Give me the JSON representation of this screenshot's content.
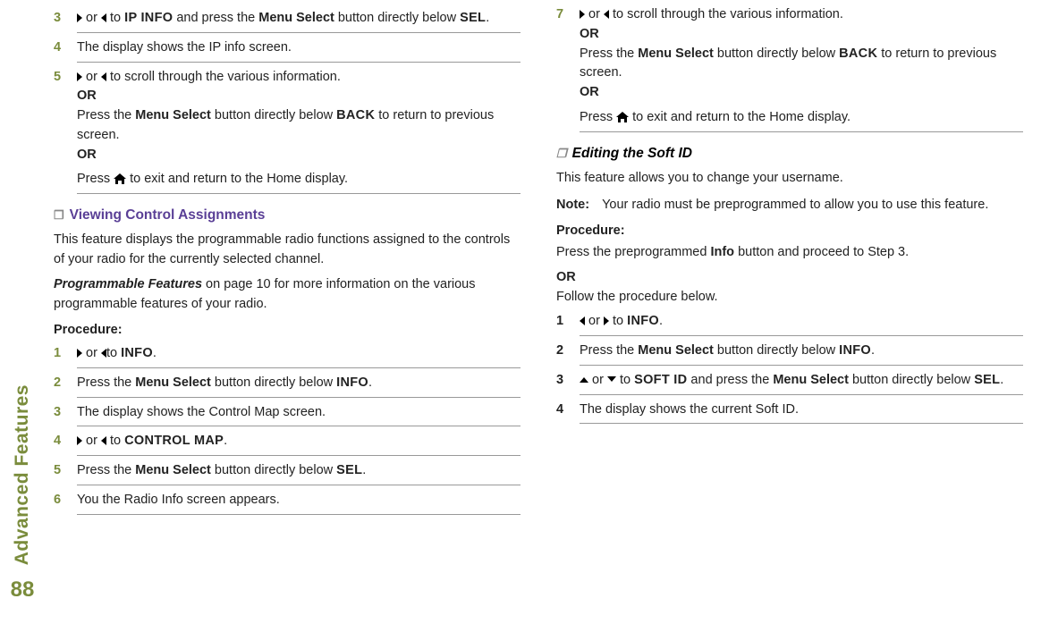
{
  "sidebar": {
    "title": "Advanced Features",
    "page_number": "88"
  },
  "col1": {
    "step3": {
      "num": "3",
      "text_a": " or ",
      "text_b": " to ",
      "ip_info": "IP INFO",
      "text_c": " and press the ",
      "menu_select": "Menu Select",
      "text_d": " button directly below ",
      "sel": "SEL",
      "period": "."
    },
    "step4": {
      "num": "4",
      "text": "The display shows the IP info screen."
    },
    "step5": {
      "num": "5",
      "line1_a": " or ",
      "line1_b": " to scroll through the various information.",
      "or1": "OR",
      "line2_a": "Press the ",
      "menu_select": "Menu Select",
      "line2_b": " button directly below ",
      "back": "BACK",
      "line2_c": " to return to previous screen.",
      "or2": "OR",
      "line3_a": "Press ",
      "line3_b": " to exit and return to the Home display."
    },
    "heading_vca": "Viewing Control Assignments",
    "vca_intro": "This feature displays the programmable radio functions assigned to the controls of your radio for the currently selected channel.",
    "vca_ref_a": " Programmable Features",
    "vca_ref_b": " on page 10 for more information on the various programmable features of your radio.",
    "proc": "Procedure:",
    "vca1": {
      "num": "1",
      "a": " or ",
      "b": "to ",
      "info": "INFO",
      "period": "."
    },
    "vca2": {
      "num": "2",
      "a": "Press the ",
      "ms": "Menu Select",
      "b": " button directly below ",
      "info": "INFO",
      "period": "."
    },
    "vca3": {
      "num": "3",
      "text": "The display shows the Control Map screen."
    },
    "vca4": {
      "num": "4",
      "a": " or ",
      "b": " to ",
      "cm": "CONTROL MAP",
      "period": "."
    },
    "vca5": {
      "num": "5",
      "a": "Press the ",
      "ms": "Menu Select",
      "b": " button directly below ",
      "sel": "SEL",
      "period": "."
    }
  },
  "col2": {
    "step6": {
      "num": "6",
      "text": "You the Radio Info screen appears."
    },
    "step7": {
      "num": "7",
      "line1_a": " or ",
      "line1_b": " to scroll through the various information.",
      "or1": "OR",
      "line2_a": "Press the ",
      "ms": "Menu Select",
      "line2_b": " button directly below ",
      "back": "BACK",
      "line2_c": " to return to previous screen.",
      "or2": "OR",
      "line3_a": "Press ",
      "line3_b": " to exit and return to the Home display."
    },
    "heading_softid": "Editing the Soft ID",
    "softid_intro": "This feature allows you to change your username.",
    "note_label": "Note:",
    "note_text": "Your radio must be preprogrammed to allow you to use this feature.",
    "proc": "Procedure:",
    "proc_a": "Press the preprogrammed ",
    "proc_info": "Info",
    "proc_b": " button and proceed to Step 3.",
    "proc_or": "OR",
    "proc_follow": "Follow the procedure below.",
    "s1": {
      "num": "1",
      "a": " or ",
      "b": " to ",
      "info": "INFO",
      "period": "."
    },
    "s2": {
      "num": "2",
      "a": "Press the ",
      "ms": "Menu Select",
      "b": " button directly below ",
      "info": "INFO",
      "period": "."
    },
    "s3": {
      "num": "3",
      "a": " or ",
      "b": " to ",
      "softid": "SOFT ID",
      "c": " and press the ",
      "ms": "Menu Select",
      "d": " button directly below ",
      "sel": "SEL",
      "period": "."
    },
    "s4": {
      "num": "4",
      "text": "The display shows the current Soft ID."
    }
  }
}
